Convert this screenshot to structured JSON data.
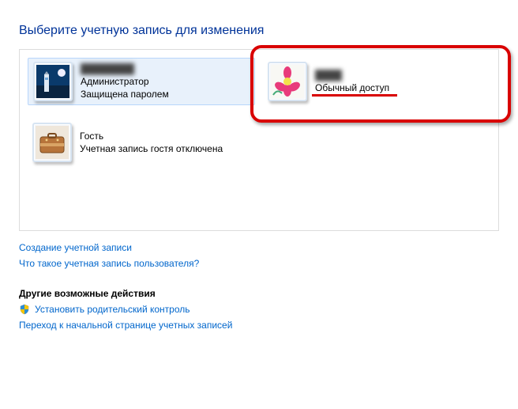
{
  "page": {
    "title": "Выберите учетную запись для изменения"
  },
  "accounts": [
    {
      "name": "████████",
      "line1": "Администратор",
      "line2": "Защищена паролем",
      "avatar": "lighthouse",
      "selected": true
    },
    {
      "name": "████",
      "line1": "Обычный доступ",
      "line2": "",
      "avatar": "flower",
      "selected": false,
      "highlighted": true
    },
    {
      "name": "Гость",
      "line1": "Учетная запись гостя отключена",
      "line2": "",
      "avatar": "suitcase",
      "selected": false
    }
  ],
  "links": {
    "create_account": "Создание учетной записи",
    "what_is_account": "Что такое учетная запись пользователя?"
  },
  "other_actions": {
    "heading": "Другие возможные действия",
    "parental_control": "Установить родительский контроль",
    "goto_home": "Переход к начальной странице учетных записей"
  }
}
